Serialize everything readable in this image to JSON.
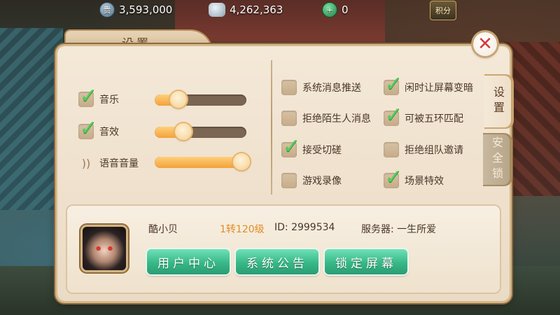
{
  "currency": {
    "coins": "3,593,000",
    "silver": "4,262,363",
    "jade": "0",
    "score_label": "积分"
  },
  "panel": {
    "title": "设置",
    "close_symbol": "✕"
  },
  "audio": {
    "music": {
      "label": "音乐",
      "checked": true,
      "level": 0.22
    },
    "effects": {
      "label": "音效",
      "checked": true,
      "level": 0.32
    },
    "voice": {
      "label": "语音音量",
      "level": 0.98
    }
  },
  "options": [
    {
      "label": "系统消息推送",
      "checked": false
    },
    {
      "label": "闲时让屏幕变暗",
      "checked": true
    },
    {
      "label": "拒绝陌生人消息",
      "checked": false
    },
    {
      "label": "可被五环匹配",
      "checked": true
    },
    {
      "label": "接受切磋",
      "checked": true
    },
    {
      "label": "拒绝组队邀请",
      "checked": false
    },
    {
      "label": "游戏录像",
      "checked": false
    },
    {
      "label": "场景特效",
      "checked": true
    }
  ],
  "side_tabs": {
    "settings": "设置",
    "security": "安全锁"
  },
  "player": {
    "name": "酷小贝",
    "level": "1转120级",
    "id": "ID: 2999534",
    "server": "服务器: 一生所爱"
  },
  "buttons": {
    "user_center": "用户中心",
    "announcement": "系统公告",
    "lock_screen": "锁定屏幕"
  },
  "icons": {
    "coin": "coin-icon",
    "silver": "silver-ingot-icon",
    "jade": "jade-add-icon",
    "voice": "speaker-icon",
    "check": "checkmark-icon"
  }
}
